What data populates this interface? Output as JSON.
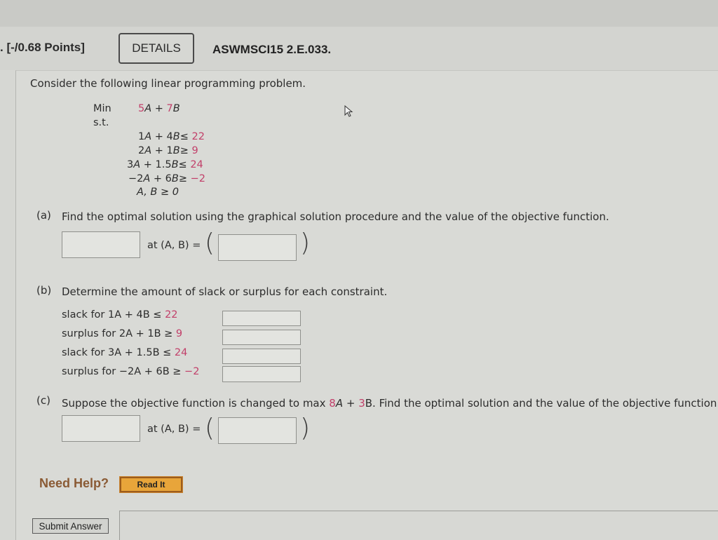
{
  "header": {
    "points": ". [-/0.68 Points]",
    "details_label": "DETAILS",
    "question_code": "ASWMSCI15 2.E.033."
  },
  "intro": "Consider the following linear programming problem.",
  "problem": {
    "min_label": "Min",
    "st_label": "s.t.",
    "objective": {
      "a": "5",
      "b": "7"
    },
    "constraints": [
      {
        "a": "1",
        "b": "4",
        "sign": "≤",
        "rhs": "22"
      },
      {
        "a": "2",
        "b": "1",
        "sign": "≥",
        "rhs": "9"
      },
      {
        "a": "3",
        "b": "1.5",
        "sign": "≤",
        "rhs": "24"
      },
      {
        "a": "−2",
        "b": "6",
        "sign": "≥",
        "rhs": "−2"
      }
    ],
    "nonneg": "A, B ≥ 0"
  },
  "part_a": {
    "label": "(a)",
    "text": "Find the optimal solution using the graphical solution procedure and the value of the objective function.",
    "at_label": "at (A, B) =",
    "value_input": "",
    "point_input": ""
  },
  "part_b": {
    "label": "(b)",
    "text": "Determine the amount of slack or surplus for each constraint.",
    "rows": [
      {
        "prefix": "slack for ",
        "expr": "1A + 4B ≤ ",
        "rhs": "22",
        "value": ""
      },
      {
        "prefix": "surplus for ",
        "expr": "2A + 1B ≥ ",
        "rhs": "9",
        "value": ""
      },
      {
        "prefix": "slack for ",
        "expr": "3A + 1.5B ≤ ",
        "rhs": "24",
        "value": ""
      },
      {
        "prefix": "surplus for ",
        "expr": "−2A + 6B ≥ ",
        "rhs": "−2",
        "value": ""
      }
    ]
  },
  "part_c": {
    "label": "(c)",
    "text_before": "Suppose the objective function is changed to max ",
    "coef_a": "8",
    "mid": "A + ",
    "coef_b": "3",
    "text_after": "B. Find the optimal solution and the value of the objective function.",
    "at_label": "at (A, B) =",
    "value_input": "",
    "point_input": ""
  },
  "help": {
    "need_help": "Need Help?",
    "read_it": "Read It"
  },
  "submit_label": "Submit Answer",
  "colors": {
    "highlight": "#c2406a",
    "help_text": "#8a5a34",
    "read_it_bg": "#e8a53a"
  }
}
